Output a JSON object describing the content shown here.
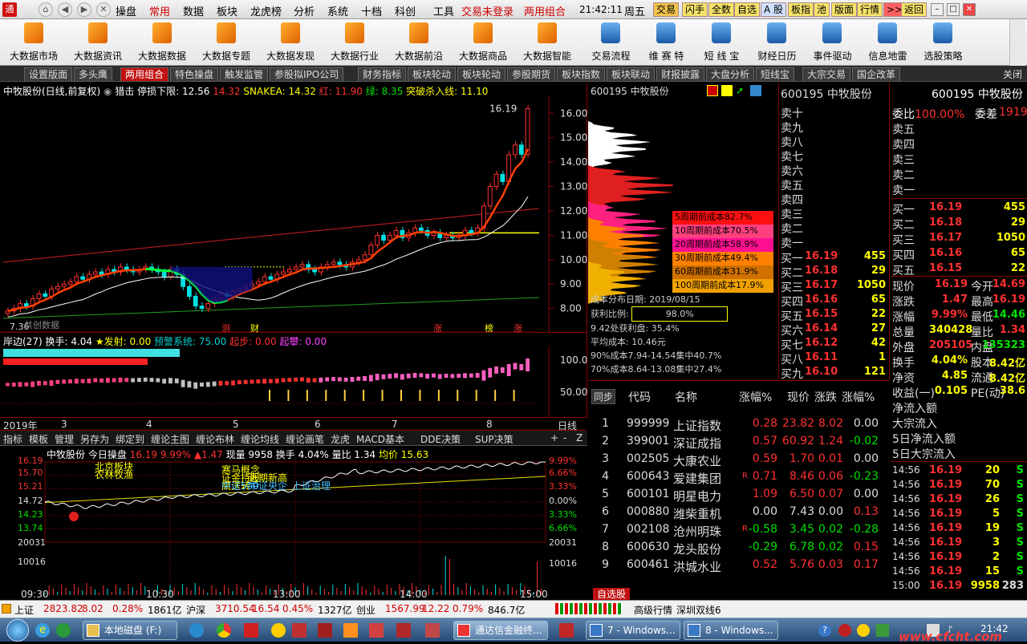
{
  "menu": {
    "items": [
      "操盘",
      "常用",
      "数据",
      "板块",
      "龙虎榜",
      "分析",
      "系统",
      "十档",
      "科创",
      "工具"
    ],
    "trade_status": "交易未登录",
    "margin": "两用组合",
    "clock": "21:42:11",
    "weekday": "周五",
    "right_buttons": [
      "交易",
      "闪手",
      "全数",
      "自选",
      "A 股",
      "板指",
      "池",
      "版面",
      "行情",
      ">>",
      "返回"
    ]
  },
  "toolbar": [
    "大数据市场",
    "大数据资讯",
    "大数据数据",
    "大数据专题",
    "大数据发现",
    "大数据行业",
    "大数据前沿",
    "大数据商品",
    "大数据智能",
    "交易流程",
    "维 赛 特",
    "短 线 宝",
    "财经日历",
    "事件驱动",
    "信息地雷",
    "选股策略"
  ],
  "tabs": {
    "items": [
      "设置版面",
      "多头鹰",
      "两用组合",
      "特色操盘",
      "触发监管",
      "参股拟IPO公司",
      "财务指标",
      "板块轮动",
      "板块轮动",
      "参股期货",
      "板块指数",
      "板块联动",
      "财报披露",
      "大盘分析",
      "短线宝",
      "大宗交易",
      "国企改革"
    ],
    "active": 2,
    "close": "关闭"
  },
  "kline": {
    "header": [
      "中牧股份(日线,前复权)",
      "猎击",
      "停损下限: 12.56",
      "14.32",
      "SNAKEA: 14.32",
      "红: 11.90",
      "绿: 8.35",
      "突破杀入线: 11.10"
    ],
    "yticks": [
      "16.00",
      "15.00",
      "14.00",
      "13.00",
      "12.00",
      "11.00",
      "10.00",
      "9.00",
      "8.00"
    ],
    "peak": "16.19",
    "low": "7.36",
    "marks": [
      "测",
      "财",
      "涨",
      "榜",
      "涨"
    ],
    "note": "共创数据",
    "closes": [
      7.9,
      8.0,
      8.2,
      8.1,
      8.4,
      8.6,
      8.5,
      8.8,
      8.9,
      9.0,
      9.1,
      9.3,
      9.2,
      9.4,
      9.5,
      9.4,
      9.6,
      9.5,
      9.7,
      9.6,
      9.5,
      9.6,
      9.7,
      9.6,
      9.5,
      9.3,
      9.6,
      9.4,
      8.9,
      8.5,
      8.1,
      8.0,
      8.2,
      8.4,
      8.6,
      8.5,
      8.7,
      8.8,
      8.9,
      9.0,
      9.1,
      9.3,
      9.2,
      9.4,
      9.5,
      9.6,
      9.7,
      9.8,
      9.6,
      9.5,
      9.7,
      9.8,
      9.9,
      9.8,
      9.7,
      9.9,
      10.0,
      10.2,
      10.6,
      11.0,
      10.8,
      11.0,
      11.2,
      10.9,
      11.1,
      11.3,
      11.2,
      11.0,
      11.1,
      10.9,
      11.0,
      10.9,
      11.0,
      11.2,
      11.1,
      11.3,
      12.2,
      13.0,
      13.5,
      13.2,
      14.3,
      14.7,
      14.32,
      16.19
    ]
  },
  "indicator": {
    "header": [
      "岸边(27)",
      "换手: 4.04",
      "★发射: 0.00",
      "预警系统: 75.00",
      "起步: 0.00",
      "起攀: 0.00"
    ],
    "yticks": [
      "100.0",
      "50.00"
    ]
  },
  "date_axis": {
    "labels": [
      "2019年",
      "3",
      "4",
      "5",
      "6",
      "7",
      "8"
    ],
    "period": "日线"
  },
  "func_bar": [
    "指标",
    "模板",
    "管理",
    "另存为",
    "绑定到",
    "缠论主图",
    "缠论布林",
    "缠论均线",
    "缠论画笔",
    "龙虎",
    "MACD基本",
    "DDE决策",
    "SUP决策"
  ],
  "intraday": {
    "header": [
      "中牧股份",
      "今日操盘",
      "16.19",
      "9.99%",
      "▲1.47",
      "现量 9958",
      "换手 4.04%",
      "量比 1.34",
      "均价 15.63"
    ],
    "left_ticks": [
      "16.19",
      "15.70",
      "15.21",
      "14.72",
      "14.23",
      "13.74",
      "20031",
      "10016"
    ],
    "right_ticks": [
      "9.99%",
      "6.66%",
      "3.33%",
      "0.00%",
      "3.33%",
      "6.66%",
      "9.99%",
      "20031",
      "10016"
    ],
    "times": [
      "09:30",
      "10:30",
      "13:00",
      "14:00",
      "15:00"
    ],
    "notes": [
      "北京板块",
      "农林牧渔",
      "寒马概念",
      "证金持股",
      "高送转",
      "近期新高",
      "中证500",
      "中证央企",
      "上证治理"
    ]
  },
  "chips": {
    "header": "600195 中牧股份",
    "rows": [
      {
        "label": "5周期前成本82.7%",
        "color": "#ff1010"
      },
      {
        "label": "10周期前成本70.5%",
        "color": "#ff4080"
      },
      {
        "label": "20周期前成本58.9%",
        "color": "#ff1090"
      },
      {
        "label": "30周期前成本49.4%",
        "color": "#ff8000"
      },
      {
        "label": "60周期前成本31.9%",
        "color": "#d07000"
      },
      {
        "label": "100周期前成本17.9%",
        "color": "#f0a000"
      }
    ],
    "date": "2019/08/15",
    "ratio": "98.0%",
    "stats": [
      "9.42处获利盘: 35.4%",
      "平均成本: 10.46元",
      "90%成本7.94-14.54集中40.7%",
      "70%成本8.64-13.08集中27.4%"
    ]
  },
  "order_book": {
    "code": "600195",
    "name": "中牧股份",
    "sell_labels": [
      "卖十",
      "卖九",
      "卖八",
      "卖七",
      "卖六",
      "卖五",
      "卖四",
      "卖三",
      "卖二",
      "卖一"
    ],
    "buys": [
      {
        "l": "买一",
        "p": "16.19",
        "v": "455"
      },
      {
        "l": "买二",
        "p": "16.18",
        "v": "29"
      },
      {
        "l": "买三",
        "p": "16.17",
        "v": "1050"
      },
      {
        "l": "买四",
        "p": "16.16",
        "v": "65"
      },
      {
        "l": "买五",
        "p": "16.15",
        "v": "22"
      },
      {
        "l": "买六",
        "p": "16.14",
        "v": "27"
      },
      {
        "l": "买七",
        "p": "16.12",
        "v": "42"
      },
      {
        "l": "买八",
        "p": "16.11",
        "v": "1"
      },
      {
        "l": "买九",
        "p": "16.10",
        "v": "121"
      }
    ]
  },
  "quote": {
    "title": "600195 中牧股份",
    "weibi_label": "委比",
    "weibi": "100.00%",
    "weicha_label": "委差",
    "weicha": "1919",
    "sells": [
      "卖五",
      "卖四",
      "卖三",
      "卖二",
      "卖一"
    ],
    "buys": [
      {
        "l": "买一",
        "p": "16.19",
        "v": "455"
      },
      {
        "l": "买二",
        "p": "16.18",
        "v": "29"
      },
      {
        "l": "买三",
        "p": "16.17",
        "v": "1050"
      },
      {
        "l": "买四",
        "p": "16.16",
        "v": "65"
      },
      {
        "l": "买五",
        "p": "16.15",
        "v": "22"
      }
    ],
    "stats": [
      [
        "现价",
        "16.19",
        "今开",
        "14.69"
      ],
      [
        "涨跌",
        "1.47",
        "最高",
        "16.19"
      ],
      [
        "涨幅",
        "9.99%",
        "最低",
        "14.46"
      ],
      [
        "总量",
        "340428",
        "量比",
        "1.34"
      ],
      [
        "外盘",
        "205105",
        "内盘",
        "135323"
      ],
      [
        "换手",
        "4.04%",
        "股本",
        "8.42亿"
      ],
      [
        "净资",
        "4.85",
        "流通",
        "8.42亿"
      ],
      [
        "收益(一)",
        "0.105",
        "PE(动)",
        "38.6"
      ]
    ],
    "flows": [
      "净流入额",
      "大宗流入",
      "5日净流入额",
      "5日大宗流入"
    ],
    "ticks": [
      [
        "14:56",
        "16.19",
        "20",
        "S"
      ],
      [
        "14:56",
        "16.19",
        "70",
        "S"
      ],
      [
        "14:56",
        "16.19",
        "26",
        "S"
      ],
      [
        "14:56",
        "16.19",
        "5",
        "S"
      ],
      [
        "14:56",
        "16.19",
        "19",
        "S"
      ],
      [
        "14:56",
        "16.19",
        "3",
        "S"
      ],
      [
        "14:56",
        "16.19",
        "2",
        "S"
      ],
      [
        "14:56",
        "16.19",
        "15",
        "S"
      ],
      [
        "15:00",
        "16.19",
        "9958",
        "283"
      ]
    ]
  },
  "table": {
    "headers": [
      "同步",
      "代码",
      "名称",
      "涨幅%",
      "现价",
      "涨跌",
      "涨幅%"
    ],
    "tab": "自选股",
    "rows": [
      [
        "1",
        "999999",
        "上证指数",
        "0.28",
        "23.82",
        "8.02",
        "0.00",
        "",
        "up"
      ],
      [
        "2",
        "399001",
        "深证成指",
        "0.57",
        "60.92",
        "1.24",
        "-0.02",
        "",
        "up"
      ],
      [
        "3",
        "002505",
        "大康农业",
        "0.59",
        "1.70",
        "0.01",
        "0.00",
        "",
        "up"
      ],
      [
        "4",
        "600643",
        "爱建集团",
        "0.71",
        "8.46",
        "0.06",
        "-0.23",
        "R",
        "up"
      ],
      [
        "5",
        "600101",
        "明星电力",
        "1.09",
        "6.50",
        "0.07",
        "0.00",
        "",
        "up"
      ],
      [
        "6",
        "000880",
        "潍柴重机",
        "0.00",
        "7.43",
        "0.00",
        "0.13",
        "",
        "flat"
      ],
      [
        "7",
        "002108",
        "沧州明珠",
        "-0.58",
        "3.45",
        "0.02",
        "-0.28",
        "R",
        "down"
      ],
      [
        "8",
        "600630",
        "龙头股份",
        "-0.29",
        "6.78",
        "0.02",
        "0.15",
        "",
        "down"
      ],
      [
        "9",
        "600461",
        "洪城水业",
        "0.52",
        "5.76",
        "0.03",
        "0.17",
        "",
        "up"
      ]
    ]
  },
  "status": [
    [
      "上证",
      "2823.82",
      "8.02",
      "0.28%",
      "1861亿"
    ],
    [
      "沪深",
      "3710.54",
      "16.54",
      "0.45%",
      "1327亿"
    ],
    [
      "创业",
      "1567.99",
      "12.22",
      "0.79%",
      "846.7亿"
    ]
  ],
  "status_extra": [
    "高级行情",
    "深圳双线6"
  ],
  "taskbar": {
    "items": [
      "本地磁盘 (F:)",
      "通达信金融终...",
      "7 - Windows...",
      "8 - Windows..."
    ],
    "clock": "21:42",
    "watermark": "www.cfcht.com"
  }
}
